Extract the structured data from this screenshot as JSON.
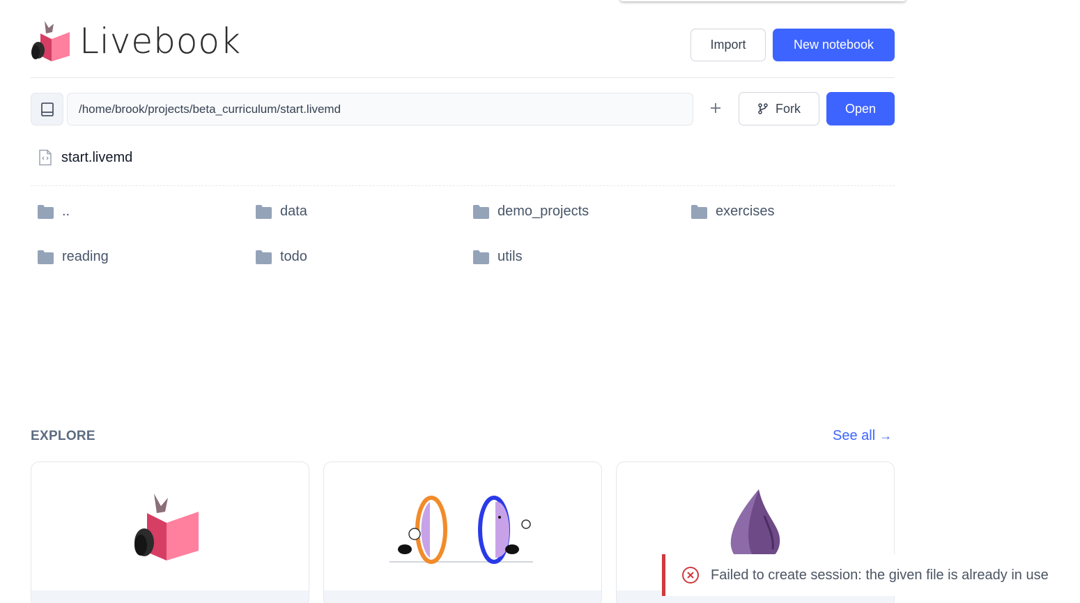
{
  "header": {
    "brand": "Livebook",
    "import_label": "Import",
    "new_notebook_label": "New notebook"
  },
  "file_browser": {
    "path_value": "/home/brook/projects/beta_curriculum/start.livemd",
    "fork_label": "Fork",
    "open_label": "Open",
    "selected_file": "start.livemd",
    "entries": [
      "..",
      "data",
      "demo_projects",
      "exercises",
      "reading",
      "todo",
      "utils"
    ]
  },
  "explore": {
    "title": "EXPLORE",
    "see_all_label": "See all",
    "see_all_arrow": "→",
    "cards": [
      {
        "image": "livebook-logo-illustration"
      },
      {
        "image": "portals-illustration"
      },
      {
        "image": "elixir-drop-illustration"
      }
    ]
  },
  "toast": {
    "message": "Failed to create session: the given file is already in use",
    "icon": "error-circle-icon",
    "accent_color": "#d0393f"
  },
  "colors": {
    "primary": "#3e64ff",
    "folder": "#94a3b8"
  }
}
